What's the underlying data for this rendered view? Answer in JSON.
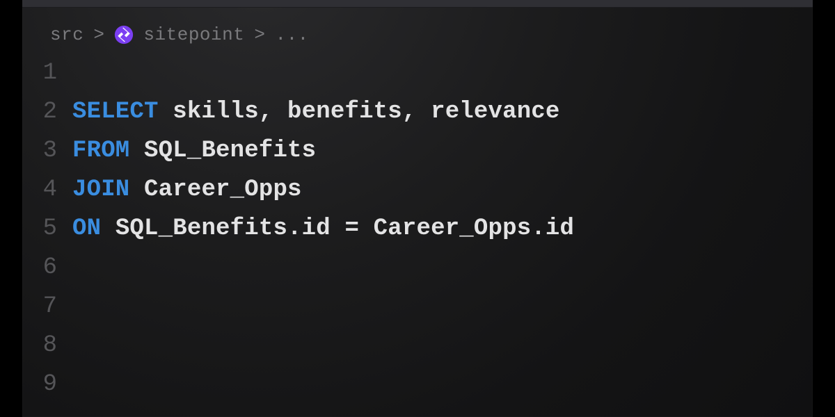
{
  "breadcrumb": {
    "root": "src",
    "sep": ">",
    "item": "sitepoint",
    "tail": "..."
  },
  "gutter": {
    "l1": "1",
    "l2": "2",
    "l3": "3",
    "l4": "4",
    "l5": "5",
    "l6": "6",
    "l7": "7",
    "l8": "8",
    "l9": "9"
  },
  "code": {
    "l2": {
      "kw": "SELECT",
      "rest": " skills, benefits, relevance"
    },
    "l3": {
      "kw": "FROM",
      "rest": " SQL_Benefits"
    },
    "l4": {
      "kw": "JOIN",
      "rest": " Career_Opps"
    },
    "l5": {
      "kw": "ON",
      "rest": " SQL_Benefits.id = Career_Opps.id"
    }
  }
}
